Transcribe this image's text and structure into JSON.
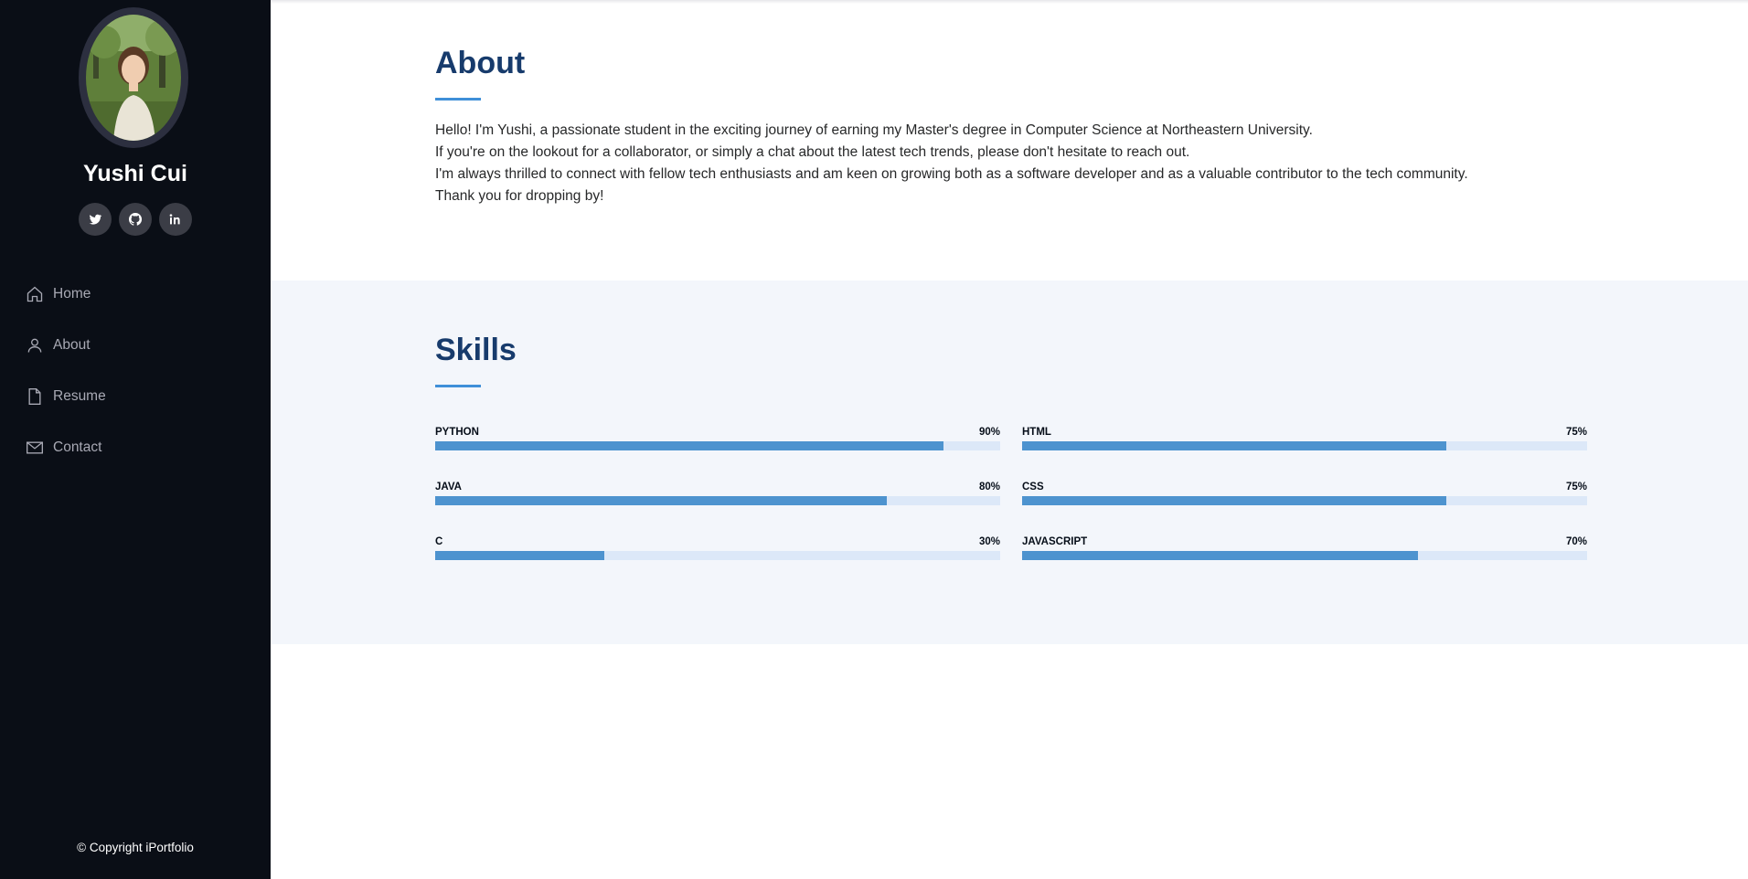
{
  "profile": {
    "name": "Yushi Cui"
  },
  "social": [
    {
      "name": "twitter-icon"
    },
    {
      "name": "github-icon"
    },
    {
      "name": "linkedin-icon"
    }
  ],
  "nav": [
    {
      "label": "Home",
      "icon": "home-icon"
    },
    {
      "label": "About",
      "icon": "person-icon"
    },
    {
      "label": "Resume",
      "icon": "file-icon"
    },
    {
      "label": "Contact",
      "icon": "envelope-icon"
    }
  ],
  "footer": {
    "copyright": "© Copyright iPortfolio"
  },
  "about": {
    "title": "About",
    "lines": [
      "Hello! I'm Yushi, a passionate student in the exciting journey of earning my Master's degree in Computer Science at Northeastern University.",
      "If you're on the lookout for a collaborator, or simply a chat about the latest tech trends, please don't hesitate to reach out.",
      "I'm always thrilled to connect with fellow tech enthusiasts and am keen on growing both as a software developer and as a valuable contributor to the tech community.",
      "Thank you for dropping by!"
    ]
  },
  "skills": {
    "title": "Skills",
    "items": [
      {
        "label": "PYTHON",
        "value": "90%",
        "level": 90
      },
      {
        "label": "HTML",
        "value": "75%",
        "level": 75
      },
      {
        "label": "JAVA",
        "value": "80%",
        "level": 80
      },
      {
        "label": "CSS",
        "value": "75%",
        "level": 75
      },
      {
        "label": "C",
        "value": "30%",
        "level": 30
      },
      {
        "label": "JAVASCRIPT",
        "value": "70%",
        "level": 70
      }
    ]
  },
  "colors": {
    "sidebar_bg": "#0a0e16",
    "heading": "#173b6c",
    "accent": "#3f8fd8",
    "bar_fill": "#4d93cf",
    "bar_track": "#dce8f8",
    "skills_bg": "#f3f6fb"
  }
}
